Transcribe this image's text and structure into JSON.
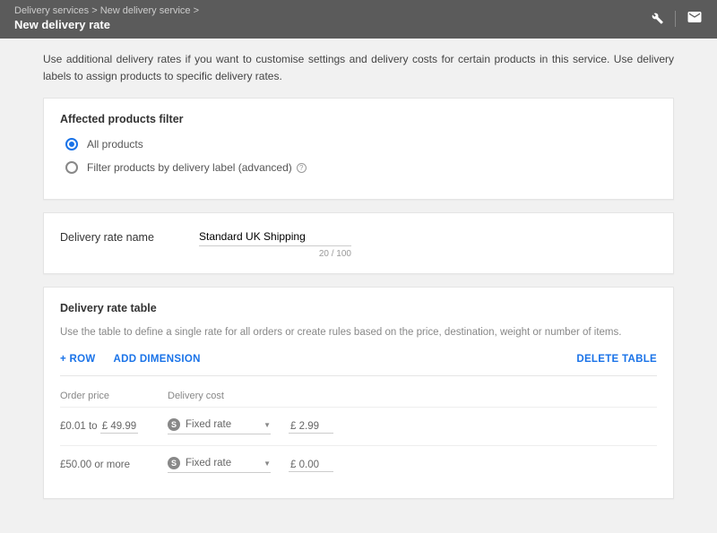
{
  "header": {
    "breadcrumb": [
      "Delivery services",
      "New delivery service"
    ],
    "title": "New delivery rate"
  },
  "intro": "Use additional delivery rates if you want to customise settings and delivery costs for certain products in this service. Use delivery labels to assign products to specific delivery rates.",
  "filter": {
    "title": "Affected products filter",
    "opt_all": "All products",
    "opt_label": "Filter products by delivery label (advanced)"
  },
  "rate_name": {
    "label": "Delivery rate name",
    "value": "Standard UK Shipping",
    "count": "20 / 100"
  },
  "table": {
    "title": "Delivery rate table",
    "desc": "Use the table to define a single rate for all orders or create rules based on the price, destination, weight or number of items.",
    "add_row": "+ ROW",
    "add_dim": "ADD DIMENSION",
    "delete": "DELETE TABLE",
    "head_price": "Order price",
    "head_cost": "Delivery cost",
    "rows": [
      {
        "from": "£0.01",
        "to_label": "to",
        "to_currency": "£",
        "to_value": "49.99",
        "type": "Fixed rate",
        "amount_currency": "£",
        "amount": "2.99"
      },
      {
        "from": "£50.00",
        "to_label": "or more",
        "type": "Fixed rate",
        "amount_currency": "£",
        "amount": "0.00"
      }
    ]
  }
}
